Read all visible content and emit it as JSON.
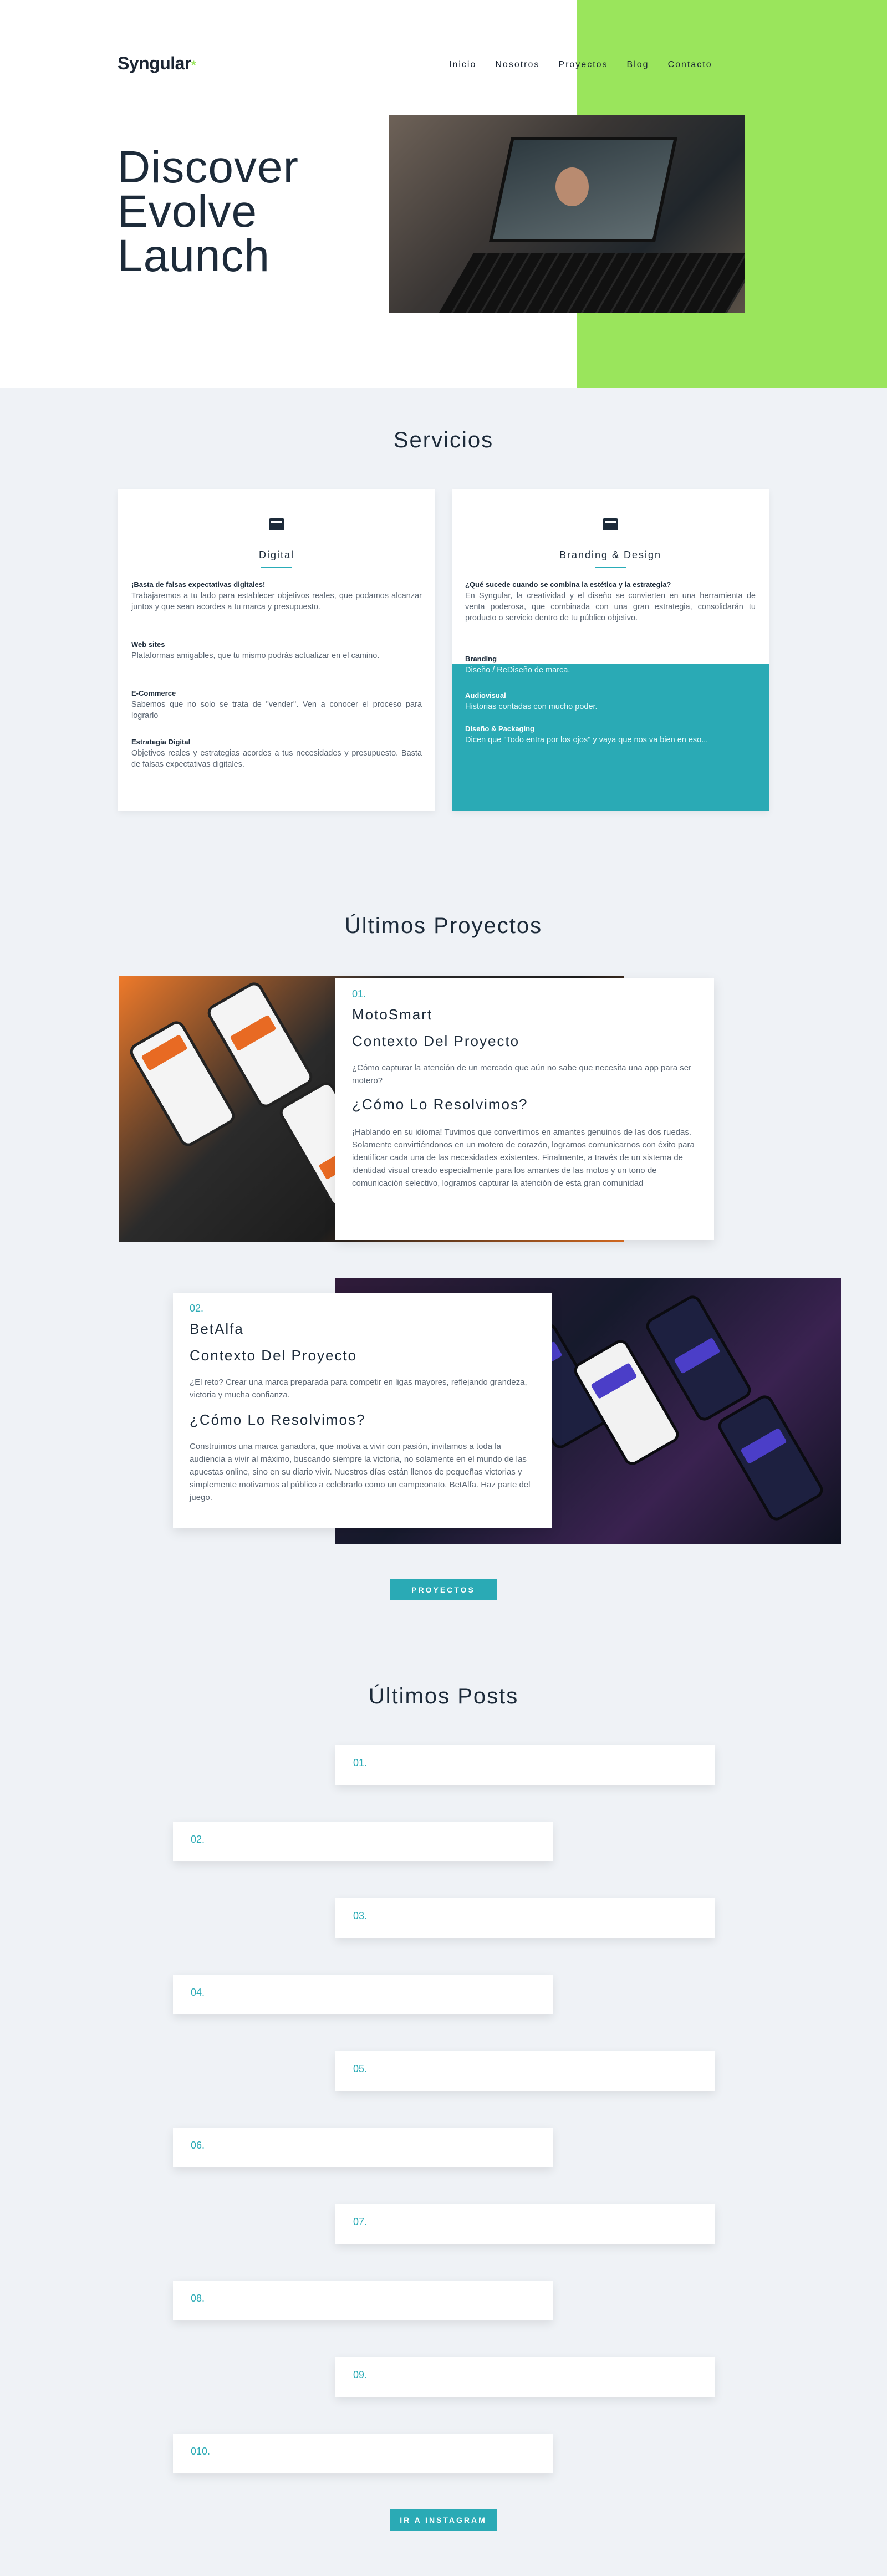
{
  "brand": {
    "logo": "Syngular",
    "logo_mark": "*",
    "accent": "#9ae55c",
    "teal": "#2aaab5"
  },
  "nav": {
    "items": [
      "Inicio",
      "Nosotros",
      "Proyectos",
      "Blog",
      "Contacto"
    ]
  },
  "hero": {
    "line1": "Discover",
    "line2": "Evolve",
    "line3": "Launch",
    "photo_icon": "laptop-video-call-photo"
  },
  "services": {
    "title": "Servicios",
    "digital": {
      "title": "Digital",
      "icon": "browser-window-icon",
      "items": [
        {
          "heading": "¡Basta de falsas expectativas digitales!",
          "text": "Trabajaremos a tu lado para establecer objetivos reales, que podamos alcanzar juntos y que sean acordes a tu marca y presupuesto."
        },
        {
          "heading": "Web sites",
          "text": "Plataformas amigables, que tu mismo podrás actualizar en el camino."
        },
        {
          "heading": "E-Commerce",
          "text": "Sabemos que no solo se trata de \"vender\". Ven a conocer el proceso para lograrlo"
        },
        {
          "heading": "Estrategia Digital",
          "text": "Objetivos reales y estrategias acordes a tus necesidades y presupuesto. Basta de falsas expectativas digitales."
        }
      ]
    },
    "branding": {
      "title": "Branding & Design",
      "icon": "window-layout-icon",
      "intro_heading": "¿Qué sucede cuando se combina la estética y la estrategia?",
      "intro_text": "En Syngular, la creatividad y el diseño se convierten en una herramienta de venta poderosa, que combinada con una gran estrategia, consolidarán tu producto o servicio dentro de tu público objetivo.",
      "items": [
        {
          "heading": "Branding",
          "text": "Diseño / ReDiseño de marca."
        },
        {
          "heading": "Audiovisual",
          "text": "Historias contadas con mucho poder."
        },
        {
          "heading": "Diseño & Packaging",
          "text": "Dicen que \"Todo entra por los ojos\" y vaya que nos va bien en eso..."
        }
      ]
    }
  },
  "projects": {
    "title": "Últimos Proyectos",
    "items": [
      {
        "num": "01.",
        "name": "MotoSmart",
        "context_title": "Contexto Del Proyecto",
        "context_text": "¿Cómo capturar la atención de un mercado que aún no sabe que necesita una app para ser motero?",
        "solve_title": "¿Cómo Lo Resolvimos?",
        "solve_text": "¡Hablando en su idioma! Tuvimos que convertirnos en amantes genuinos de las dos ruedas. Solamente convirtiéndonos en un motero de corazón, logramos comunicarnos con éxito para identificar cada una de las necesidades existentes. Finalmente, a través de un sistema de identidad visual creado especialmente para los amantes de las motos y un tono de comunicación selectivo, logramos capturar la atención de esta gran comunidad"
      },
      {
        "num": "02.",
        "name": "BetAlfa",
        "context_title": "Contexto Del Proyecto",
        "context_text": "¿El reto? Crear una marca preparada para competir en ligas mayores, reflejando grandeza, victoria y mucha confianza.",
        "solve_title": "¿Cómo Lo Resolvimos?",
        "solve_text": "Construimos una marca ganadora, que motiva a vivir con pasión, invitamos a toda la audiencia a vivir al máximo, buscando siempre la victoria, no solamente en el mundo de las apuestas online, sino en su diario vivir. Nuestros días están llenos de pequeñas victorias y simplemente motivamos al público a celebrarlo como un campeonato. BetAlfa. Haz parte del juego."
      }
    ],
    "button": "PROYECTOS"
  },
  "posts": {
    "title": "Últimos Posts",
    "items": [
      "01.",
      "02.",
      "03.",
      "04.",
      "05.",
      "06.",
      "07.",
      "08.",
      "09.",
      "010."
    ],
    "button": "IR A INSTAGRAM"
  }
}
